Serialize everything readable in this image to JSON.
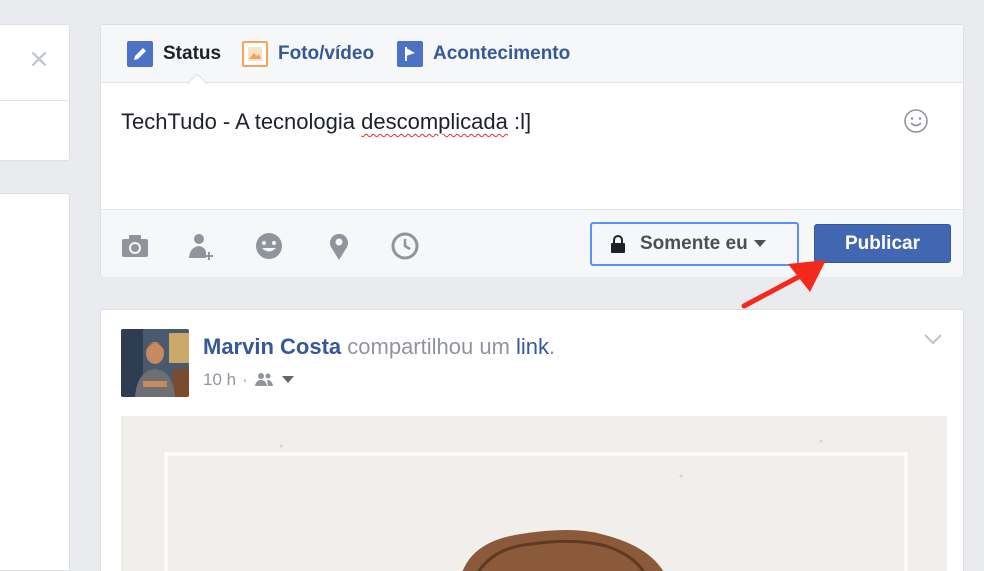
{
  "left": {
    "close_glyph": "×"
  },
  "composer": {
    "tabs": [
      {
        "label": "Status",
        "icon": "pencil-icon",
        "color": "#4b72c4"
      },
      {
        "label": "Foto/vídeo",
        "icon": "photo-icon",
        "color": "#f2a55a"
      },
      {
        "label": "Acontecimento",
        "icon": "flag-icon",
        "color": "#4b72c4"
      }
    ],
    "text_before": "TechTudo - A tecnologia ",
    "text_misspelled": "descomplicada",
    "text_after": " :l]",
    "footer_icons": [
      "camera-icon",
      "tag-people-icon",
      "feeling-icon",
      "location-icon",
      "clock-icon"
    ],
    "privacy_label": "Somente eu",
    "publish_label": "Publicar"
  },
  "post": {
    "author": "Marvin Costa",
    "verb": " compartilhou um ",
    "link_text": "link",
    "period": ".",
    "time": "10 h",
    "separator": "·"
  },
  "colors": {
    "brand": "#4267b2",
    "link": "#365899",
    "focus_ring": "#5890ff",
    "annotation_arrow": "#f5281c"
  }
}
